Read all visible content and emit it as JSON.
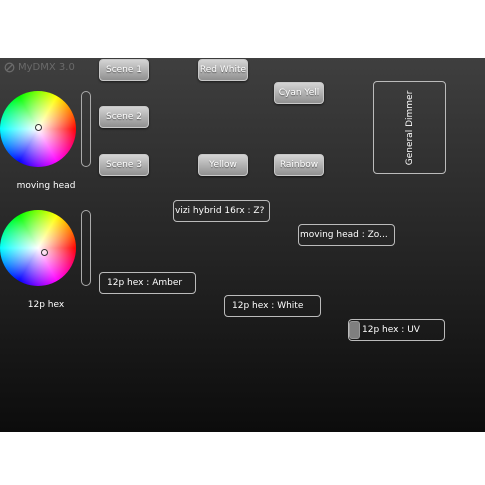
{
  "app": {
    "title": "MyDMX 3.0"
  },
  "scenes": [
    "Scene 1",
    "Scene 2",
    "Scene 3"
  ],
  "presets": [
    "Red White",
    "Cyan Yell",
    "Yellow",
    "Rainbow"
  ],
  "groups": [
    {
      "label": "moving head"
    },
    {
      "label": "12p hex"
    }
  ],
  "faders": [
    "vizi hybrid 16rx : Z?",
    "moving head : Zo...",
    "12p hex : Amber",
    "12p hex : White",
    "12p hex : UV"
  ],
  "dimmer": {
    "label": "General Dimmer"
  }
}
